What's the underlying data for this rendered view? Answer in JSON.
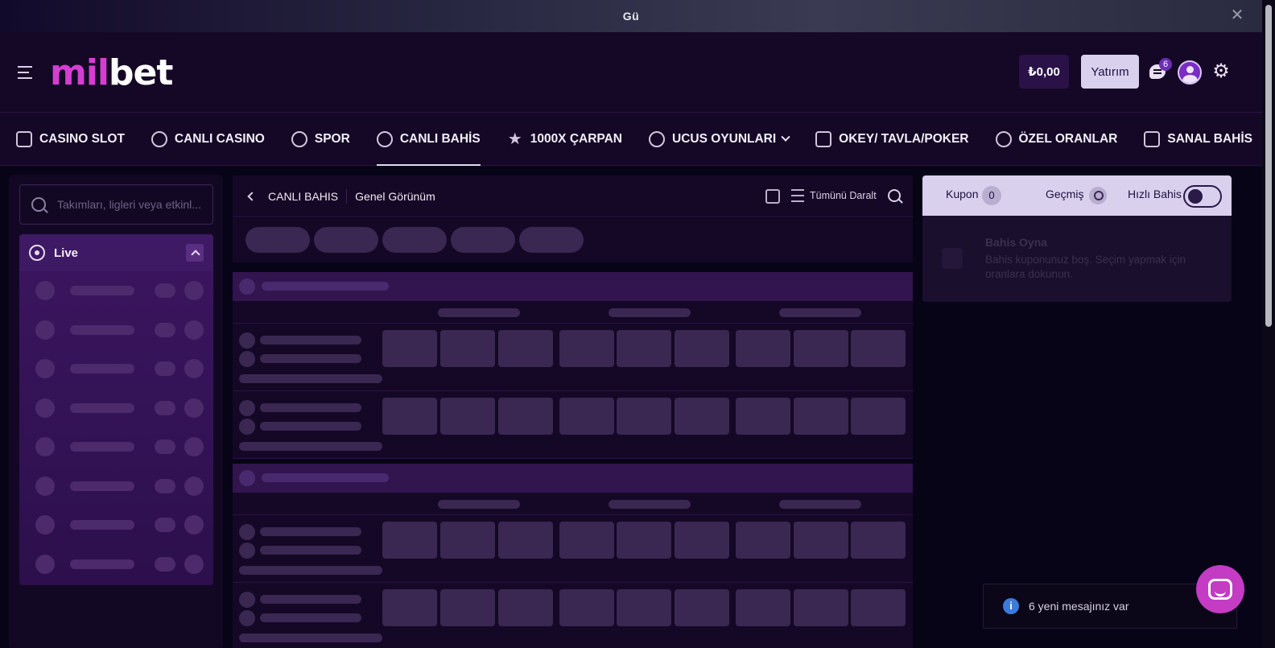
{
  "banner": {
    "text": "Gü",
    "close": "✕"
  },
  "header": {
    "logo_part1": "mil",
    "logo_part2": "bet",
    "balance": "₺0,00",
    "deposit": "Yatırım",
    "messages_count": "6"
  },
  "nav": {
    "items": [
      {
        "label": "CASINO SLOT",
        "icon": "slot-icon"
      },
      {
        "label": "CANLI CASINO",
        "icon": "chip-icon"
      },
      {
        "label": "SPOR",
        "icon": "football-icon"
      },
      {
        "label": "CANLI BAHİS",
        "icon": "live-icon",
        "active": true
      },
      {
        "label": "1000X ÇARPAN",
        "icon": "star-icon"
      },
      {
        "label": "UCUS OYUNLARI",
        "icon": "bomb-icon",
        "dropdown": true
      },
      {
        "label": "OKEY/ TAVLA/POKER",
        "icon": "cards-icon"
      },
      {
        "label": "ÖZEL ORANLAR",
        "icon": "football-icon"
      },
      {
        "label": "SANAL BAHİS",
        "icon": "gamepad-icon"
      }
    ]
  },
  "sidebar": {
    "search_placeholder": "Takımları, ligleri veya etkinl...",
    "live_label": "Live"
  },
  "center": {
    "breadcrumb_1": "CANLI BAHIS",
    "breadcrumb_2": "Genel Görünüm",
    "collapse_all": "Tümünü Daralt"
  },
  "coupon": {
    "tab_coupon": "Kupon",
    "coupon_count": "0",
    "tab_history": "Geçmiş",
    "tab_quick": "Hızlı Bahis",
    "empty_title": "Bahis Oyna",
    "empty_text": "Bahis kuponunuz boş. Seçim yapmak için oranlara dokunun."
  },
  "toast": {
    "text": "6 yeni mesajınız var",
    "icon": "i"
  },
  "colors": {
    "brand": "#d63ed2",
    "accent": "#d9d0ee",
    "bg": "#150826"
  }
}
